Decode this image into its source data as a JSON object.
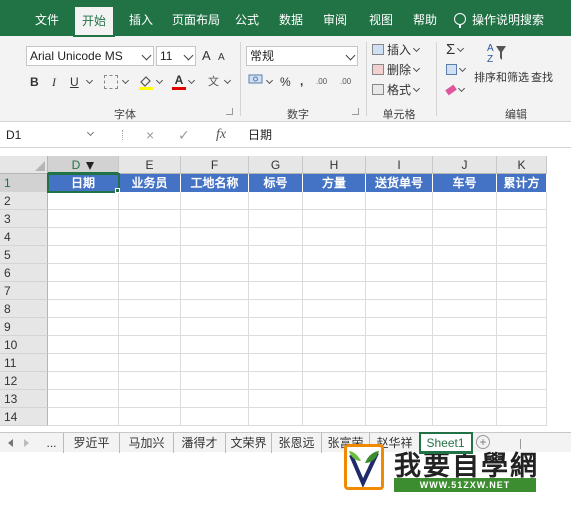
{
  "ribbon_tabs": [
    {
      "label": "文件"
    },
    {
      "label": "开始"
    },
    {
      "label": "插入"
    },
    {
      "label": "页面布局"
    },
    {
      "label": "公式"
    },
    {
      "label": "数据"
    },
    {
      "label": "审阅"
    },
    {
      "label": "视图"
    },
    {
      "label": "帮助"
    }
  ],
  "tell_me": "操作说明搜索",
  "font": {
    "name": "Arial Unicode MS",
    "size": "11",
    "grow": "A",
    "shrink": "A",
    "bold": "B",
    "italic": "I",
    "underline": "U",
    "font_color_btn": "A",
    "wen_btn": "文",
    "group_label": "字体"
  },
  "number": {
    "format": "常规",
    "percent": "%",
    "comma": ",",
    "inc_decimal": ".00",
    "dec_decimal": ".00",
    "group_label": "数字"
  },
  "cells_group": {
    "insert": "插入",
    "delete": "删除",
    "format": "格式",
    "group_label": "单元格"
  },
  "editing": {
    "sigma": "Σ",
    "sort_filter": "排序和筛选",
    "find": "查找",
    "group_label": "编辑"
  },
  "formula_bar": {
    "name_box": "D1",
    "cancel": "×",
    "enter": "✓",
    "fx": "fx",
    "content": "日期"
  },
  "columns": [
    "D",
    "E",
    "F",
    "G",
    "H",
    "I",
    "J",
    "K"
  ],
  "row_numbers": [
    "1",
    "2",
    "3",
    "4",
    "5",
    "6",
    "7",
    "8",
    "9",
    "10",
    "11",
    "12",
    "13",
    "14"
  ],
  "header_row": [
    "日期",
    "业务员",
    "工地名称",
    "标号",
    "方量",
    "送货单号",
    "车号",
    "累计方"
  ],
  "sheet_tabs": [
    {
      "label": "..."
    },
    {
      "label": "罗近平"
    },
    {
      "label": "马加兴"
    },
    {
      "label": "潘得才"
    },
    {
      "label": "文荣界"
    },
    {
      "label": "张恩远"
    },
    {
      "label": "张富荣"
    },
    {
      "label": "赵华祥"
    },
    {
      "label": "Sheet1"
    }
  ],
  "watermark": {
    "text": "我要自學網",
    "url": "WWW.51ZXW.NET"
  }
}
